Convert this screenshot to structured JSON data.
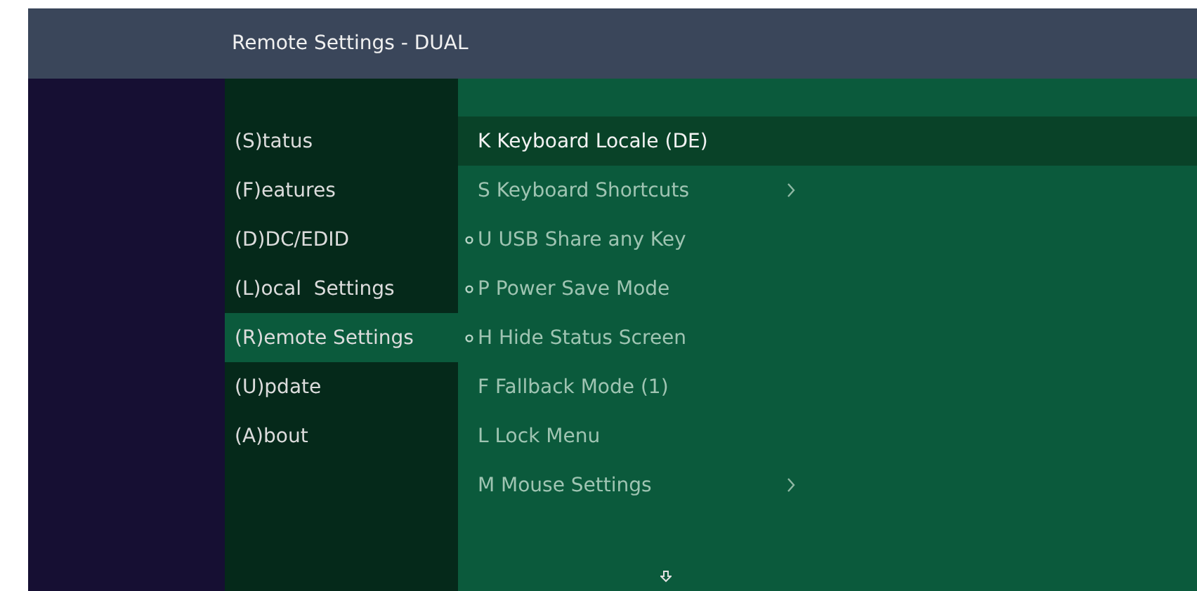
{
  "window": {
    "title": "Remote Settings - DUAL"
  },
  "sidebar": {
    "items": [
      {
        "label": "(S)tatus",
        "selected": false
      },
      {
        "label": "(F)eatures",
        "selected": false
      },
      {
        "label": "(D)DC/EDID",
        "selected": false
      },
      {
        "label": "(L)ocal  Settings",
        "selected": false
      },
      {
        "label": "(R)emote Settings",
        "selected": true
      },
      {
        "label": "(U)pdate",
        "selected": false
      },
      {
        "label": "(A)bout",
        "selected": false
      }
    ]
  },
  "menu": {
    "items": [
      {
        "label": "K Keyboard Locale (DE)",
        "selected": true,
        "marked": false,
        "submenu": false
      },
      {
        "label": "S Keyboard Shortcuts",
        "selected": false,
        "marked": false,
        "submenu": true
      },
      {
        "label": "U USB Share any Key",
        "selected": false,
        "marked": true,
        "submenu": false
      },
      {
        "label": "P Power Save Mode",
        "selected": false,
        "marked": true,
        "submenu": false
      },
      {
        "label": "H Hide Status Screen",
        "selected": false,
        "marked": true,
        "submenu": false
      },
      {
        "label": "F Fallback Mode (1)",
        "selected": false,
        "marked": false,
        "submenu": false
      },
      {
        "label": "L Lock Menu",
        "selected": false,
        "marked": false,
        "submenu": false
      },
      {
        "label": "M Mouse Settings",
        "selected": false,
        "marked": false,
        "submenu": true
      }
    ],
    "more_below": true
  }
}
